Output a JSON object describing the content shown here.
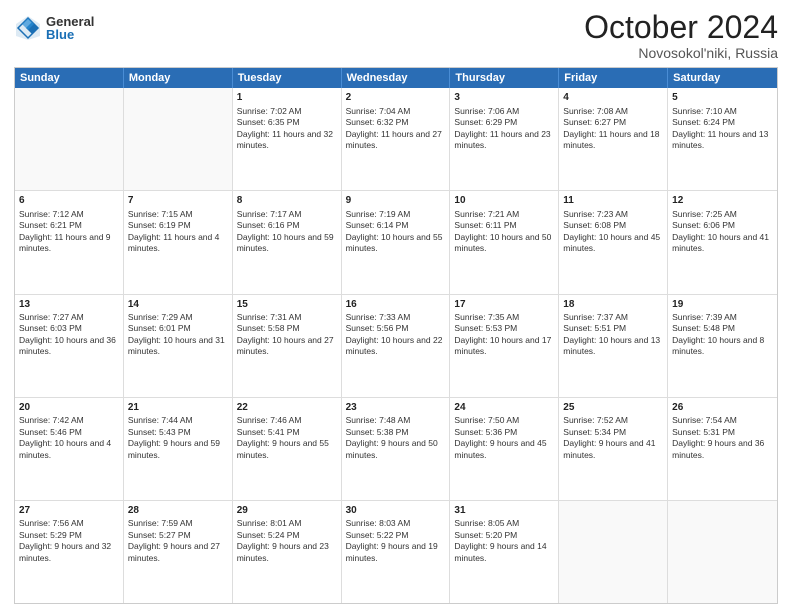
{
  "logo": {
    "general": "General",
    "blue": "Blue"
  },
  "title": "October 2024",
  "location": "Novosokol'niki, Russia",
  "days": [
    "Sunday",
    "Monday",
    "Tuesday",
    "Wednesday",
    "Thursday",
    "Friday",
    "Saturday"
  ],
  "rows": [
    [
      {
        "day": "",
        "empty": true
      },
      {
        "day": "",
        "empty": true
      },
      {
        "day": "1",
        "sunrise": "Sunrise: 7:02 AM",
        "sunset": "Sunset: 6:35 PM",
        "daylight": "Daylight: 11 hours and 32 minutes."
      },
      {
        "day": "2",
        "sunrise": "Sunrise: 7:04 AM",
        "sunset": "Sunset: 6:32 PM",
        "daylight": "Daylight: 11 hours and 27 minutes."
      },
      {
        "day": "3",
        "sunrise": "Sunrise: 7:06 AM",
        "sunset": "Sunset: 6:29 PM",
        "daylight": "Daylight: 11 hours and 23 minutes."
      },
      {
        "day": "4",
        "sunrise": "Sunrise: 7:08 AM",
        "sunset": "Sunset: 6:27 PM",
        "daylight": "Daylight: 11 hours and 18 minutes."
      },
      {
        "day": "5",
        "sunrise": "Sunrise: 7:10 AM",
        "sunset": "Sunset: 6:24 PM",
        "daylight": "Daylight: 11 hours and 13 minutes."
      }
    ],
    [
      {
        "day": "6",
        "sunrise": "Sunrise: 7:12 AM",
        "sunset": "Sunset: 6:21 PM",
        "daylight": "Daylight: 11 hours and 9 minutes."
      },
      {
        "day": "7",
        "sunrise": "Sunrise: 7:15 AM",
        "sunset": "Sunset: 6:19 PM",
        "daylight": "Daylight: 11 hours and 4 minutes."
      },
      {
        "day": "8",
        "sunrise": "Sunrise: 7:17 AM",
        "sunset": "Sunset: 6:16 PM",
        "daylight": "Daylight: 10 hours and 59 minutes."
      },
      {
        "day": "9",
        "sunrise": "Sunrise: 7:19 AM",
        "sunset": "Sunset: 6:14 PM",
        "daylight": "Daylight: 10 hours and 55 minutes."
      },
      {
        "day": "10",
        "sunrise": "Sunrise: 7:21 AM",
        "sunset": "Sunset: 6:11 PM",
        "daylight": "Daylight: 10 hours and 50 minutes."
      },
      {
        "day": "11",
        "sunrise": "Sunrise: 7:23 AM",
        "sunset": "Sunset: 6:08 PM",
        "daylight": "Daylight: 10 hours and 45 minutes."
      },
      {
        "day": "12",
        "sunrise": "Sunrise: 7:25 AM",
        "sunset": "Sunset: 6:06 PM",
        "daylight": "Daylight: 10 hours and 41 minutes."
      }
    ],
    [
      {
        "day": "13",
        "sunrise": "Sunrise: 7:27 AM",
        "sunset": "Sunset: 6:03 PM",
        "daylight": "Daylight: 10 hours and 36 minutes."
      },
      {
        "day": "14",
        "sunrise": "Sunrise: 7:29 AM",
        "sunset": "Sunset: 6:01 PM",
        "daylight": "Daylight: 10 hours and 31 minutes."
      },
      {
        "day": "15",
        "sunrise": "Sunrise: 7:31 AM",
        "sunset": "Sunset: 5:58 PM",
        "daylight": "Daylight: 10 hours and 27 minutes."
      },
      {
        "day": "16",
        "sunrise": "Sunrise: 7:33 AM",
        "sunset": "Sunset: 5:56 PM",
        "daylight": "Daylight: 10 hours and 22 minutes."
      },
      {
        "day": "17",
        "sunrise": "Sunrise: 7:35 AM",
        "sunset": "Sunset: 5:53 PM",
        "daylight": "Daylight: 10 hours and 17 minutes."
      },
      {
        "day": "18",
        "sunrise": "Sunrise: 7:37 AM",
        "sunset": "Sunset: 5:51 PM",
        "daylight": "Daylight: 10 hours and 13 minutes."
      },
      {
        "day": "19",
        "sunrise": "Sunrise: 7:39 AM",
        "sunset": "Sunset: 5:48 PM",
        "daylight": "Daylight: 10 hours and 8 minutes."
      }
    ],
    [
      {
        "day": "20",
        "sunrise": "Sunrise: 7:42 AM",
        "sunset": "Sunset: 5:46 PM",
        "daylight": "Daylight: 10 hours and 4 minutes."
      },
      {
        "day": "21",
        "sunrise": "Sunrise: 7:44 AM",
        "sunset": "Sunset: 5:43 PM",
        "daylight": "Daylight: 9 hours and 59 minutes."
      },
      {
        "day": "22",
        "sunrise": "Sunrise: 7:46 AM",
        "sunset": "Sunset: 5:41 PM",
        "daylight": "Daylight: 9 hours and 55 minutes."
      },
      {
        "day": "23",
        "sunrise": "Sunrise: 7:48 AM",
        "sunset": "Sunset: 5:38 PM",
        "daylight": "Daylight: 9 hours and 50 minutes."
      },
      {
        "day": "24",
        "sunrise": "Sunrise: 7:50 AM",
        "sunset": "Sunset: 5:36 PM",
        "daylight": "Daylight: 9 hours and 45 minutes."
      },
      {
        "day": "25",
        "sunrise": "Sunrise: 7:52 AM",
        "sunset": "Sunset: 5:34 PM",
        "daylight": "Daylight: 9 hours and 41 minutes."
      },
      {
        "day": "26",
        "sunrise": "Sunrise: 7:54 AM",
        "sunset": "Sunset: 5:31 PM",
        "daylight": "Daylight: 9 hours and 36 minutes."
      }
    ],
    [
      {
        "day": "27",
        "sunrise": "Sunrise: 7:56 AM",
        "sunset": "Sunset: 5:29 PM",
        "daylight": "Daylight: 9 hours and 32 minutes."
      },
      {
        "day": "28",
        "sunrise": "Sunrise: 7:59 AM",
        "sunset": "Sunset: 5:27 PM",
        "daylight": "Daylight: 9 hours and 27 minutes."
      },
      {
        "day": "29",
        "sunrise": "Sunrise: 8:01 AM",
        "sunset": "Sunset: 5:24 PM",
        "daylight": "Daylight: 9 hours and 23 minutes."
      },
      {
        "day": "30",
        "sunrise": "Sunrise: 8:03 AM",
        "sunset": "Sunset: 5:22 PM",
        "daylight": "Daylight: 9 hours and 19 minutes."
      },
      {
        "day": "31",
        "sunrise": "Sunrise: 8:05 AM",
        "sunset": "Sunset: 5:20 PM",
        "daylight": "Daylight: 9 hours and 14 minutes."
      },
      {
        "day": "",
        "empty": true
      },
      {
        "day": "",
        "empty": true
      }
    ]
  ]
}
